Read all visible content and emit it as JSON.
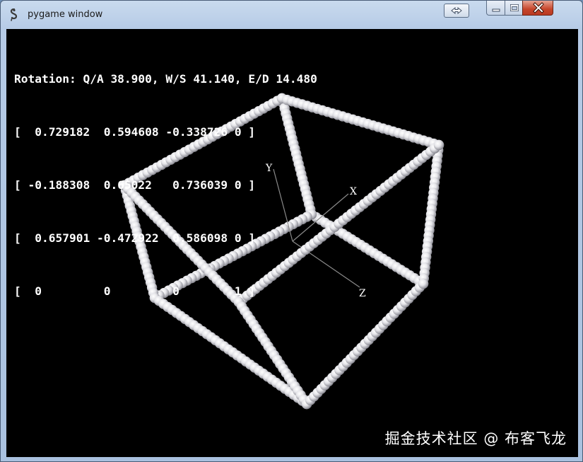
{
  "window": {
    "title": "pygame window",
    "app_icon": "pygame-snake-icon",
    "extra_button_icon": "double-arrow-icon",
    "controls": {
      "minimize_icon": "minimize-icon",
      "maximize_icon": "maximize-icon",
      "close_icon": "close-icon"
    }
  },
  "hud": {
    "rotation": "Rotation: Q/A 38.900, W/S 41.140, E/D 14.480",
    "matrix_rows": [
      "[  0.729182  0.594608 -0.338726 0 ]",
      "[ -0.188308  0.65022   0.736039 0 ]",
      "[  0.657901 -0.472922  0.586098 0 ]",
      "[  0         0         0        1 ]"
    ]
  },
  "axes": {
    "x_label": "X",
    "y_label": "Y",
    "z_label": "Z"
  },
  "scene": {
    "background": "#000000",
    "sphere_color": "#e8e8ec",
    "axis_color": "#8a8a8a"
  },
  "watermark": "掘金技术社区 @ 布客飞龙"
}
